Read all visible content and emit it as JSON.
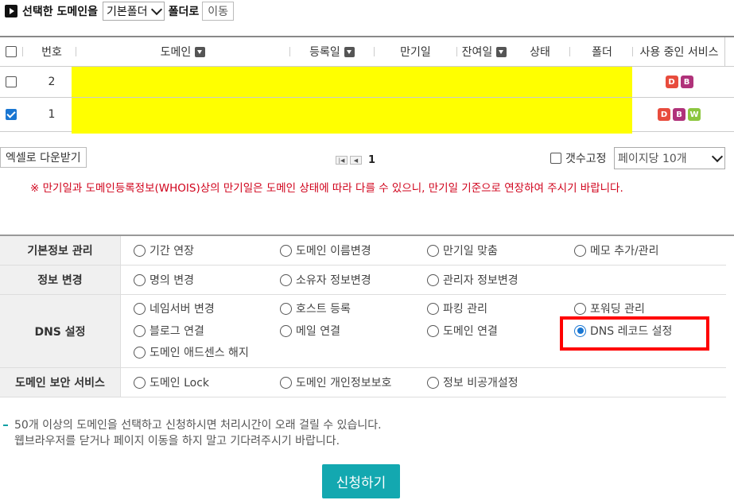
{
  "move_bar": {
    "label": "선택한 도메인을",
    "folder_select": "기본폴더",
    "suffix": "폴더로",
    "move_button": "이동"
  },
  "table": {
    "headers": {
      "number": "번호",
      "domain": "도메인",
      "registered": "등록일",
      "expiry": "만기일",
      "remaining": "잔여일",
      "status": "상태",
      "folder": "폴더",
      "services": "사용 중인 서비스"
    },
    "rows": [
      {
        "number": "2",
        "checked": false,
        "services": [
          "D",
          "B"
        ]
      },
      {
        "number": "1",
        "checked": true,
        "services": [
          "D",
          "B",
          "W"
        ]
      }
    ]
  },
  "service_colors": {
    "D": "#e84c3d",
    "B": "#b0327a",
    "W": "#8cc63f"
  },
  "pagination": {
    "excel_button": "엑셀로 다운받기",
    "current_page": "1",
    "fix_count_label": "갯수고정",
    "per_page_select": "페이지당 10개"
  },
  "notice": "※ 만기일과 도메인등록정보(WHOIS)상의 만기일은 도메인 상태에 따라 다를 수 있으니, 만기일 기준으로 연장하여 주시기 바랍니다.",
  "options": {
    "basic": {
      "title": "기본정보 관리",
      "items": [
        "기간 연장",
        "도메인 이름변경",
        "만기일 맞춤",
        "메모 추가/관리"
      ]
    },
    "info": {
      "title": "정보 변경",
      "items": [
        "명의 변경",
        "소유자 정보변경",
        "관리자 정보변경"
      ]
    },
    "dns": {
      "title": "DNS 설정",
      "items": [
        "네임서버 변경",
        "호스트 등록",
        "파킹 관리",
        "포워딩 관리",
        "블로그 연결",
        "메일 연결",
        "도메인 연결",
        "DNS 레코드 설정",
        "도메인 애드센스 해지"
      ],
      "selected": "DNS 레코드 설정"
    },
    "security": {
      "title": "도메인 보안 서비스",
      "items": [
        "도메인 Lock",
        "도메인 개인정보보호",
        "정보 비공개설정"
      ]
    }
  },
  "info_lines": [
    "50개 이상의 도메인을 선택하고 신청하시면 처리시간이 오래 걸릴 수 있습니다.",
    "웹브라우저를 닫거나 페이지 이동을 하지 말고 기다려주시기 바랍니다."
  ],
  "apply_button": "신청하기",
  "accent_color": "#13a8b0",
  "highlight_color": "#ff0000"
}
